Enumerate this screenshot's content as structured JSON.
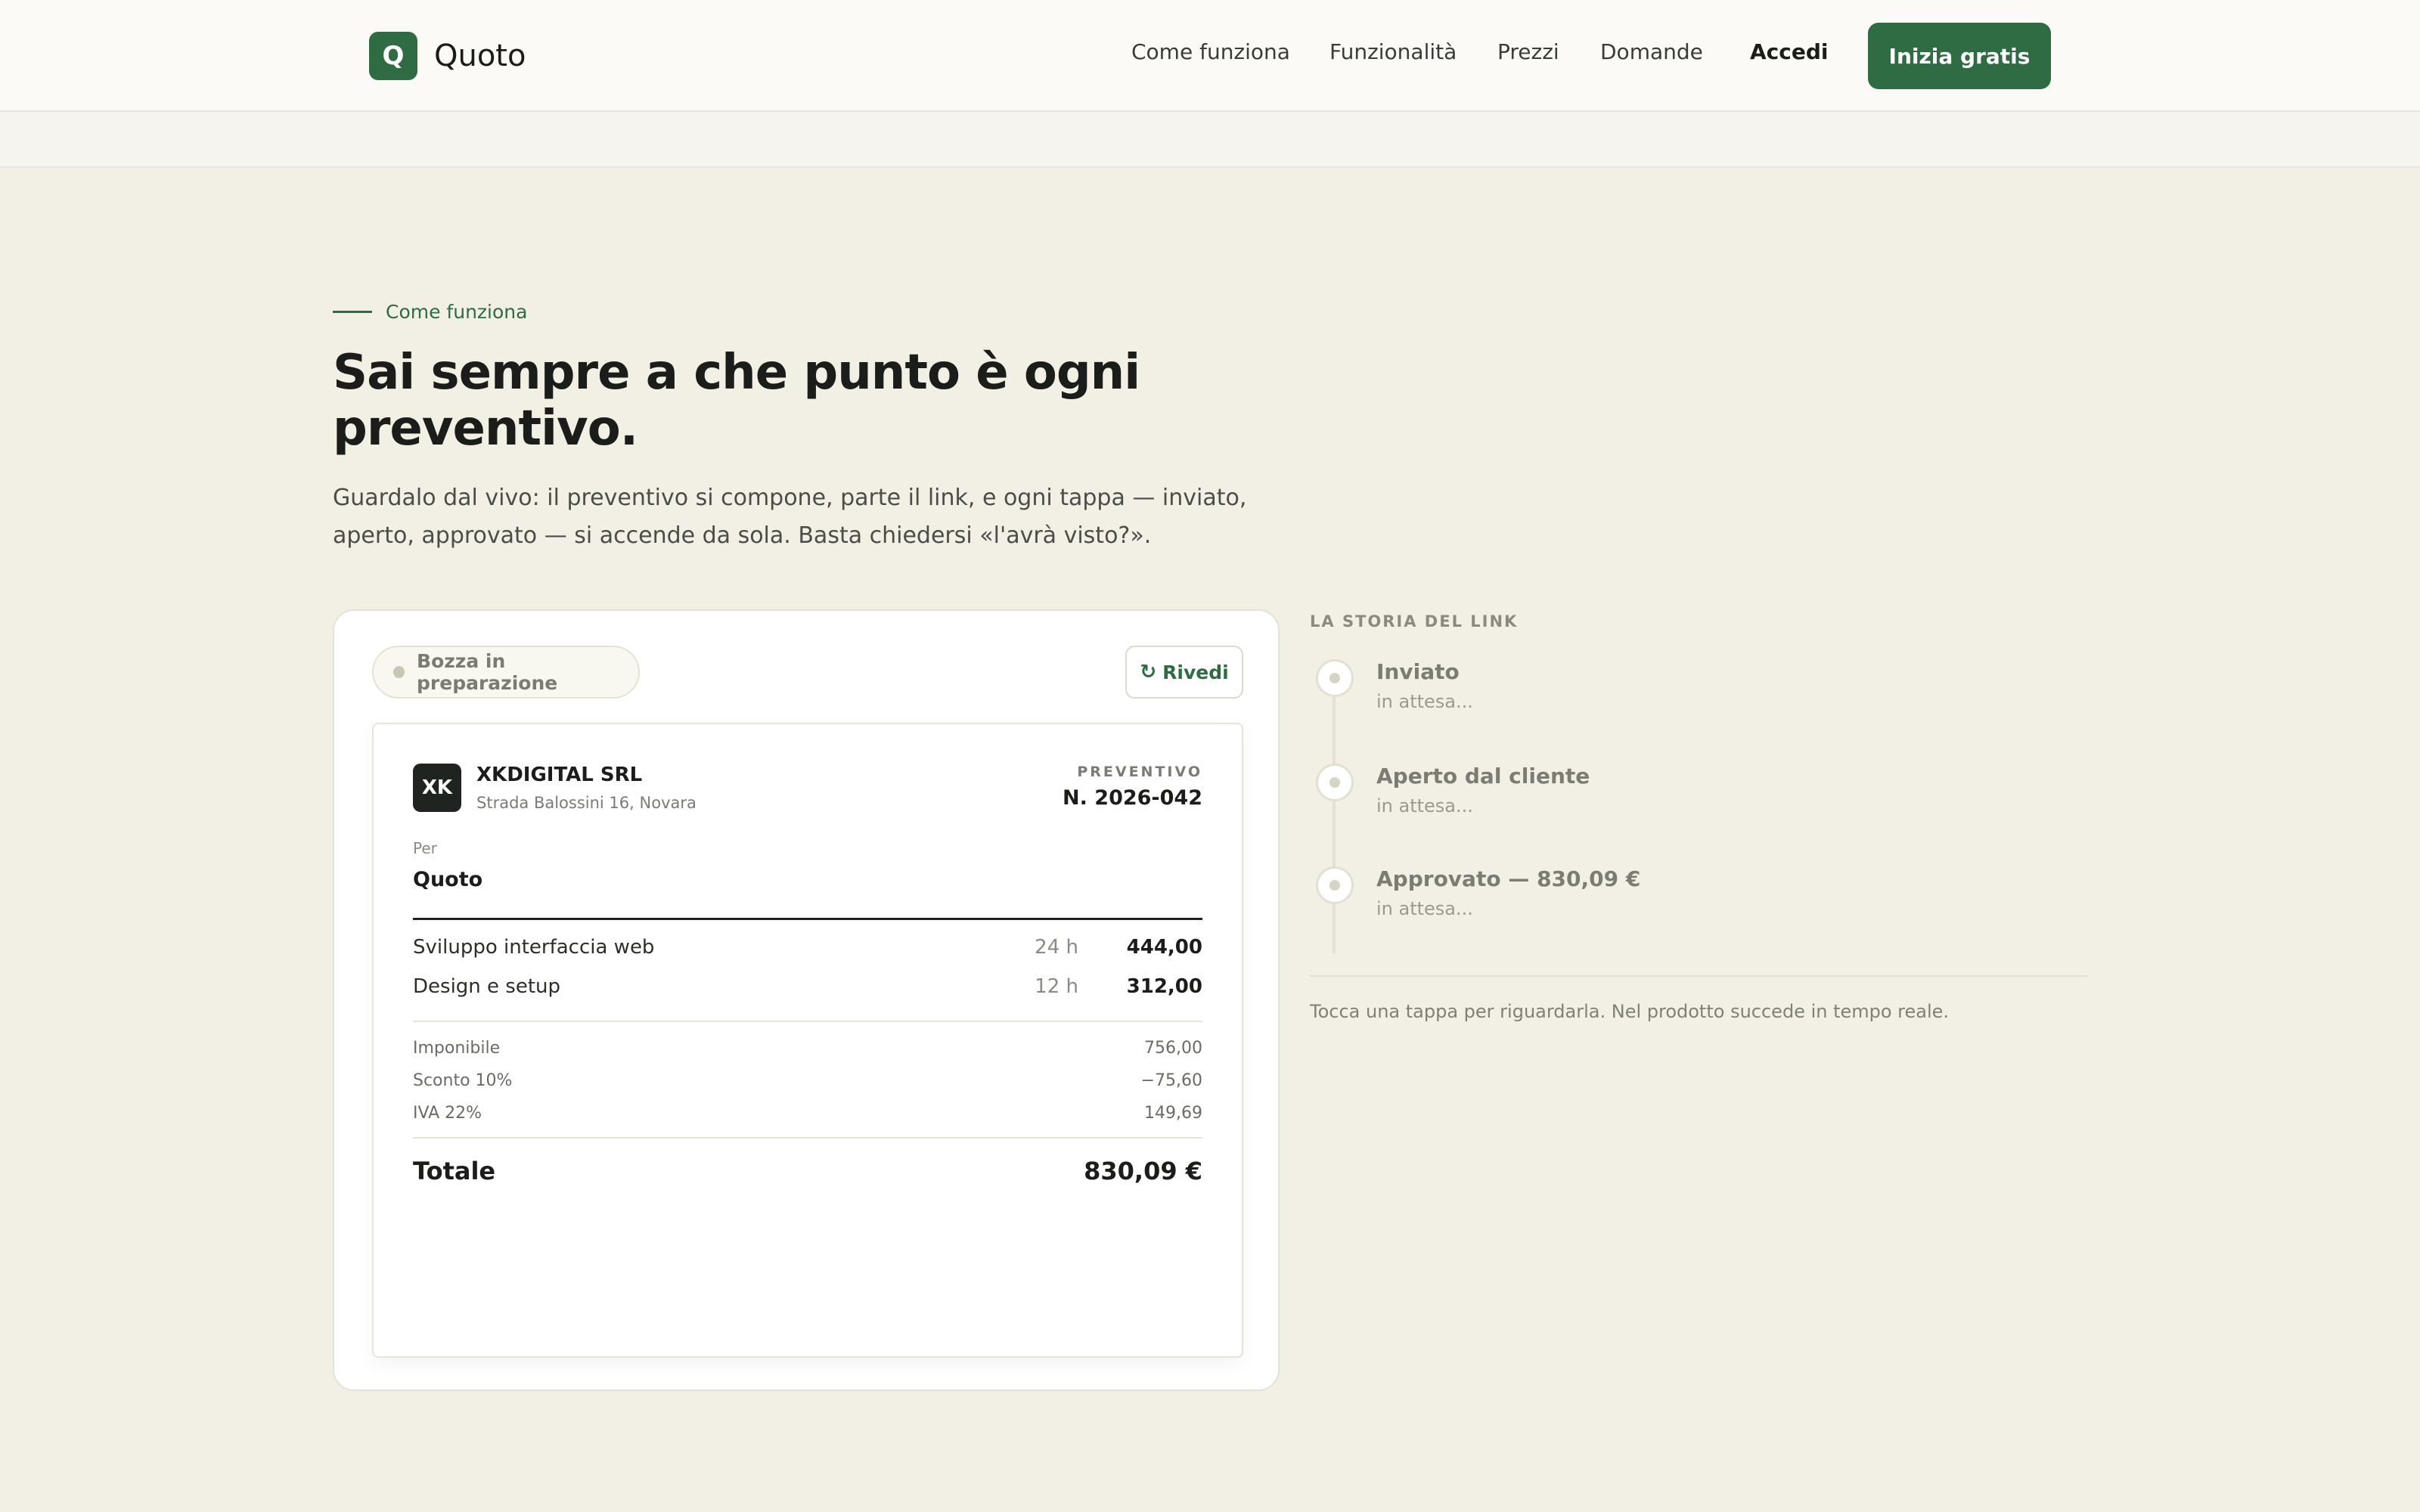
{
  "header": {
    "logo_letter": "Q",
    "brand": "Quoto",
    "nav": [
      "Come funziona",
      "Funzionalità",
      "Prezzi",
      "Domande"
    ],
    "login": "Accedi",
    "cta": "Inizia gratis"
  },
  "hero": {
    "eyebrow": "Come funziona",
    "headline": "Sai sempre a che punto è ogni preventivo.",
    "lead": "Guardalo dal vivo: il preventivo si compone, parte il link, e ogni tappa — inviato, aperto, approvato — si accende da sola. Basta chiedersi «l'avrà visto?»."
  },
  "card": {
    "status": "Bozza in preparazione",
    "replay_icon": "↻",
    "replay": "Rivedi",
    "doc": {
      "company_badge": "XK",
      "company": "XKDIGITAL SRL",
      "address": "Strada Balossini 16, Novara",
      "kind": "PREVENTIVO",
      "number": "N. 2026-042",
      "for_label": "Per",
      "for_name": "Quoto",
      "lines": [
        {
          "desc": "Sviluppo interfaccia web",
          "qty": "24 h",
          "amount": "444,00"
        },
        {
          "desc": "Design e setup",
          "qty": "12 h",
          "amount": "312,00"
        }
      ],
      "summary": [
        {
          "label": "Imponibile",
          "value": "756,00"
        },
        {
          "label": "Sconto 10%",
          "value": "−75,60"
        },
        {
          "label": "IVA 22%",
          "value": "149,69"
        }
      ],
      "total_label": "Totale",
      "total_value": "830,09 €"
    }
  },
  "timeline": {
    "title": "LA STORIA DEL LINK",
    "steps": [
      {
        "label": "Inviato",
        "sub": "in attesa..."
      },
      {
        "label": "Aperto dal cliente",
        "sub": "in attesa..."
      },
      {
        "label": "Approvato — 830,09 €",
        "sub": "in attesa..."
      }
    ],
    "note": "Tocca una tappa per riguardarla. Nel prodotto succede in tempo reale."
  }
}
